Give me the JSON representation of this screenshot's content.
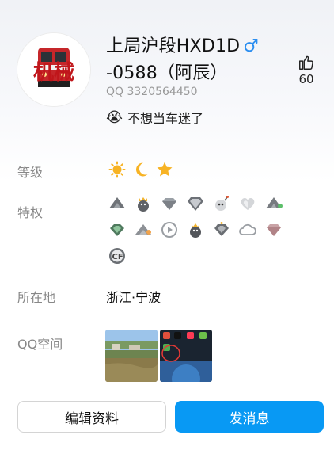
{
  "profile": {
    "name": "上局沪段HXD1D-0588（阿辰）",
    "name_line1": "上局沪段HXD1D",
    "name_line2": "-0588（阿辰）",
    "gender_symbol": "♂",
    "qq_number": "QQ 3320564450",
    "status_text": "不想当车迷了",
    "status_emoji": "😭",
    "avatar_text": "机械",
    "likes": "60"
  },
  "fields": {
    "level_label": "等级",
    "privilege_label": "特权",
    "location_label": "所在地",
    "location_value": "浙江·宁波",
    "qzone_label": "QQ空间"
  },
  "level_icons": [
    "sun-icon",
    "moon-icon",
    "star-icon"
  ],
  "privilege_icons": [
    [
      "mountain-badge-icon",
      "penguin-crown-icon",
      "diamond-icon",
      "big-diamond-icon",
      "bomb-icon",
      "heart-icon",
      "mountain-green-icon"
    ],
    [
      "green-diamond-icon",
      "mountain-orange-icon",
      "play-icon",
      "penguin-crown-icon",
      "crowned-diamond-icon",
      "cloud-icon",
      "pink-diamond-icon"
    ],
    [
      "cf-logo-icon"
    ]
  ],
  "buttons": {
    "edit_label": "编辑资料",
    "message_label": "发消息"
  },
  "colors": {
    "accent": "#0899f4",
    "gender": "#2b8ef0",
    "label_gray": "#888888"
  }
}
